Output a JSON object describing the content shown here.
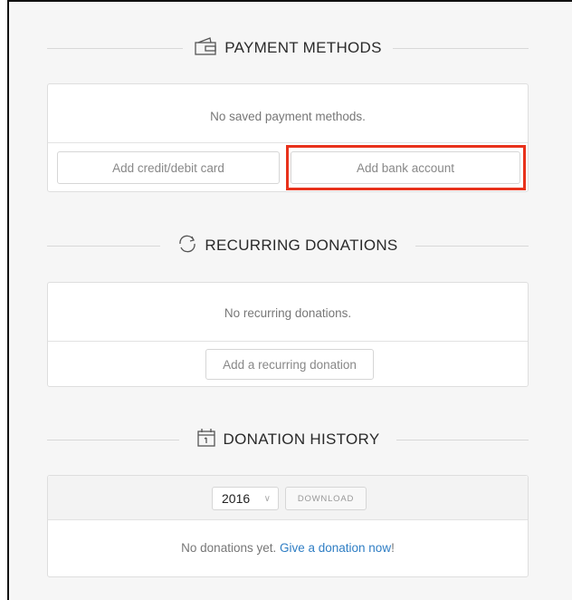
{
  "payment": {
    "title": "PAYMENT METHODS",
    "empty_message": "No saved payment methods.",
    "add_card_label": "Add credit/debit card",
    "add_bank_label": "Add bank account",
    "icon": "wallet-icon"
  },
  "recurring": {
    "title": "RECURRING DONATIONS",
    "empty_message": "No recurring donations.",
    "add_label": "Add a recurring donation",
    "icon": "refresh-icon"
  },
  "history": {
    "title": "DONATION HISTORY",
    "icon": "calendar-icon",
    "year_selected": "2016",
    "download_label": "DOWNLOAD",
    "empty_prefix": "No donations yet. ",
    "empty_link": "Give a donation now",
    "empty_suffix": "!"
  },
  "colors": {
    "highlight": "#e8321c",
    "link": "#2f7ec4"
  }
}
